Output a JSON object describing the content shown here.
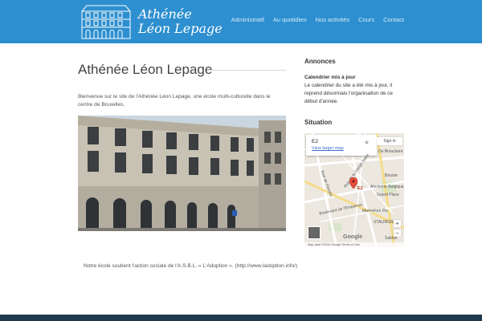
{
  "site": {
    "logo_line1": "Athénée",
    "logo_line2": "Léon Lepage"
  },
  "nav": {
    "items": [
      "Administratif",
      "Au quotidien",
      "Nos activités",
      "Cours",
      "Contact"
    ]
  },
  "main": {
    "title": "Athénée Léon Lepage",
    "intro": "Bienvenue sur le site de l'Athénée Léon Lepage, une école multi-culturelle dans le centre de Bruxelles.",
    "caption": "Notre école soutient l'action sociale de l'A.S.B.L. « L'Adoption ». (http://www.ladoption.info/)"
  },
  "sidebar": {
    "annonces_heading": "Annonces",
    "news_title": "Calendrier mis à jour",
    "news_body": "Le calendrier du site a été mis à jour, il reprend désormais l'organisation de ce début d'année.",
    "situation_heading": "Situation",
    "map": {
      "card_title": "E2",
      "larger_map": "View larger map",
      "sign_in": "Sign in",
      "marker_label": "E2",
      "street_labels": [
        "De Brouckere",
        "Rue de la Vierge Noire",
        "Bourse",
        "Ancienne Belgique",
        "Grand Place",
        "Rue de Flandre",
        "Manneken Pis",
        "STALINGRAD",
        "Boulevard de l'Empereur",
        "Sablon"
      ],
      "google": "Google",
      "attribution": "Map data ©2015 Google    Terms of Use",
      "zoom_in": "+",
      "zoom_out": "−"
    }
  },
  "colors": {
    "header": "#2d8fcf",
    "footer": "#1f3a4d",
    "link": "#3a6ecb"
  }
}
